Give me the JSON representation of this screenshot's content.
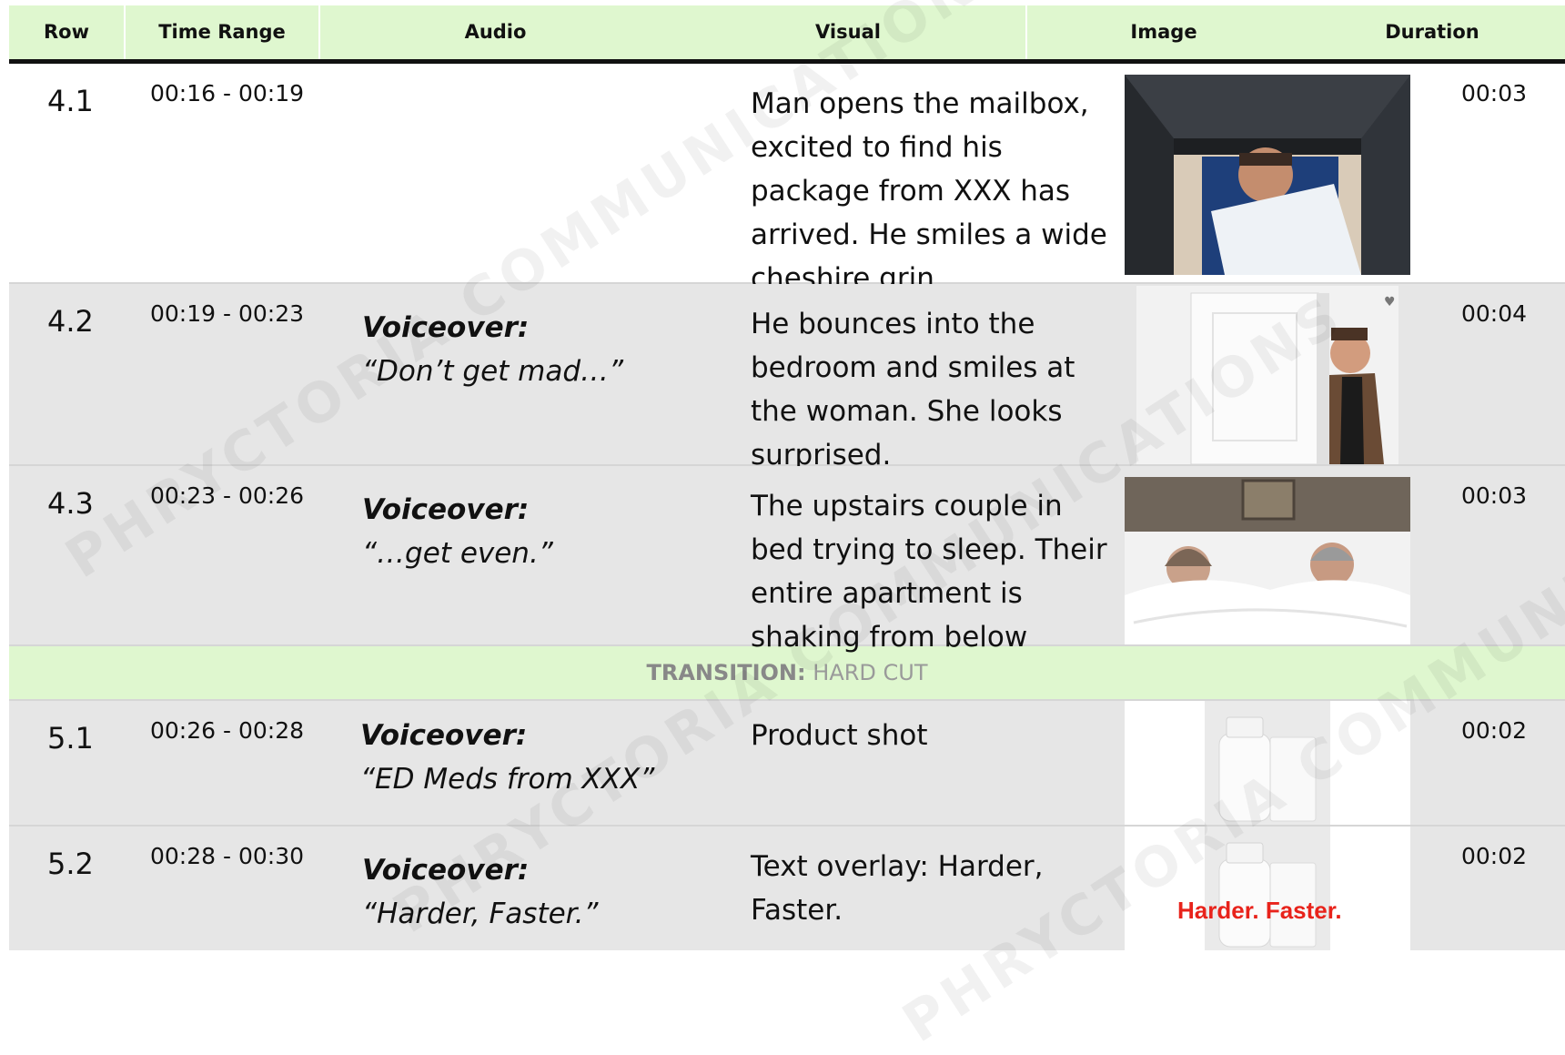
{
  "headers": {
    "row": "Row",
    "time_range": "Time Range",
    "audio": "Audio",
    "visual": "Visual",
    "image": "Image",
    "duration": "Duration"
  },
  "rows": [
    {
      "row": "4.1",
      "time": "00:16 - 00:19",
      "audio_label": "",
      "audio_text": "",
      "visual": "Man opens the mailbox, excited to find his package from XXX has arrived. He smiles a wide cheshire grin.",
      "duration": "00:03"
    },
    {
      "row": "4.2",
      "time": "00:19 - 00:23",
      "audio_label": "Voiceover:",
      "audio_text": "“Don’t get mad…”",
      "visual": "He bounces into the bedroom and smiles at the woman. She looks surprised.",
      "duration": "00:04"
    },
    {
      "row": "4.3",
      "time": "00:23 - 00:26",
      "audio_label": "Voiceover:",
      "audio_text": "“…get even.”",
      "visual": "The upstairs couple in bed trying to sleep. Their entire apartment is shaking from below",
      "duration": "00:03"
    },
    {
      "row": "5.1",
      "time": "00:26 - 00:28",
      "audio_label": "Voiceover:",
      "audio_text": "“ED Meds from XXX”",
      "visual": "Product shot",
      "duration": "00:02"
    },
    {
      "row": "5.2",
      "time": "00:28 - 00:30",
      "audio_label": "Voiceover:",
      "audio_text": "“Harder, Faster.”",
      "visual": "Text overlay: Harder, Faster.",
      "duration": "00:02",
      "image_overlay": "Harder. Faster."
    }
  ],
  "transition": {
    "label": "TRANSITION:",
    "value": "HARD CUT"
  },
  "watermark": "PHRYCTORIA COMMUNICATIONS"
}
